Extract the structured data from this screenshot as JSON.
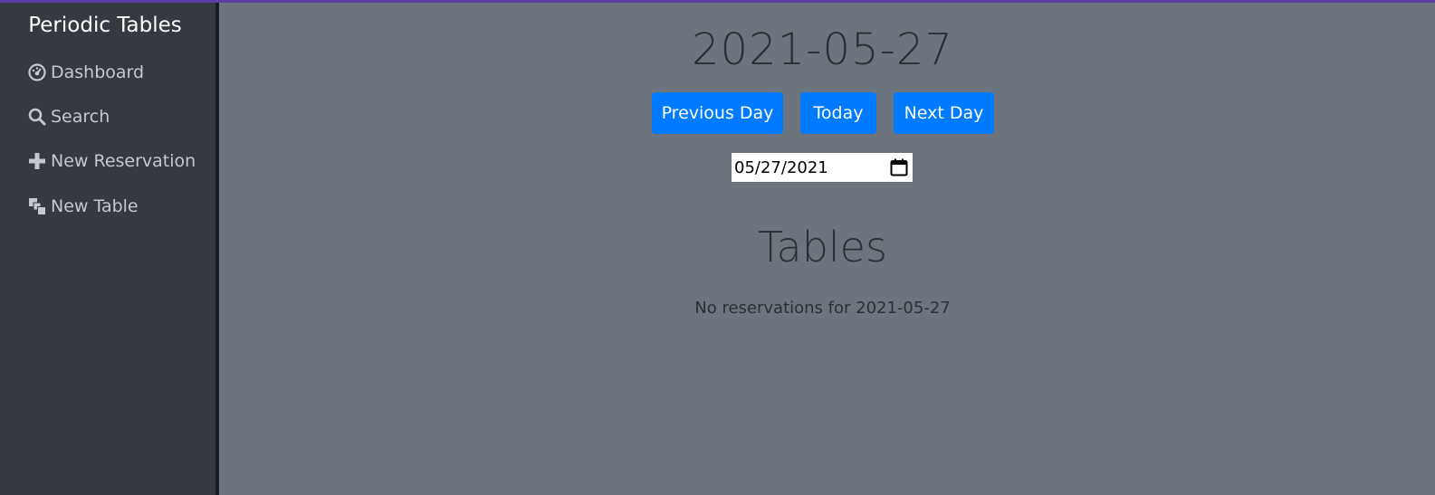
{
  "sidebar": {
    "brand": "Periodic Tables",
    "items": [
      {
        "label": "Dashboard",
        "icon": "dashboard-icon"
      },
      {
        "label": "Search",
        "icon": "search-icon"
      },
      {
        "label": "New Reservation",
        "icon": "plus-icon"
      },
      {
        "label": "New Table",
        "icon": "layers-icon"
      }
    ]
  },
  "main": {
    "date_heading": "2021-05-27",
    "buttons": {
      "previous": "Previous Day",
      "today": "Today",
      "next": "Next Day"
    },
    "date_input": {
      "value": "05/27/2021",
      "icon": "calendar-icon"
    },
    "tables_heading": "Tables",
    "no_reservations": "No reservations for 2021-05-27"
  },
  "colors": {
    "sidebar_bg": "#343a40",
    "main_bg": "#6c757d",
    "button_bg": "#007bff",
    "top_accent": "#5b3fa3"
  }
}
